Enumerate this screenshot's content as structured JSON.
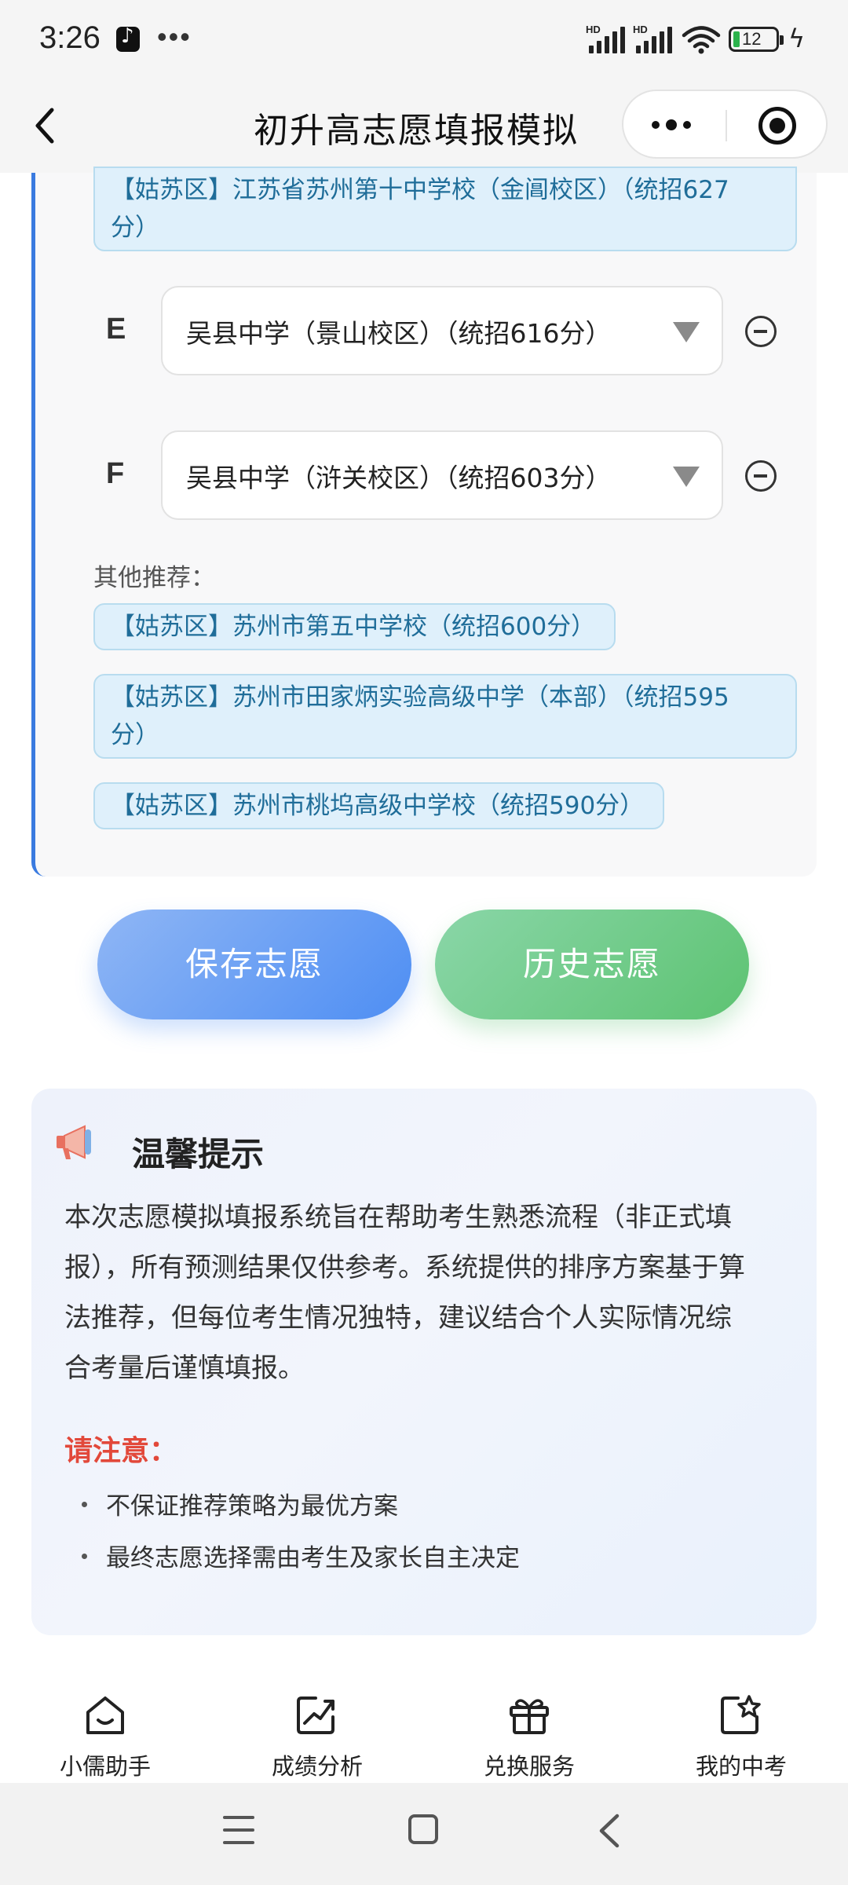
{
  "status_bar": {
    "time": "3:26",
    "more": "•••",
    "battery_level": "12",
    "icons": [
      "tiktok-icon",
      "signal-hd-icon",
      "signal-hd-icon",
      "wifi-icon",
      "battery-icon",
      "charging-bolt-icon"
    ]
  },
  "nav": {
    "title": "初升高志愿填报模拟",
    "icons": [
      "back-icon",
      "more-icon",
      "target-icon"
    ]
  },
  "volunteer": {
    "top_partial_tag": {
      "line1": "【姑苏区】江苏省苏州第十中学校（金阊校区）（统招627",
      "line2": "分）"
    },
    "rows": [
      {
        "label": "E",
        "selected": "吴县中学（景山校区）（统招616分）"
      },
      {
        "label": "F",
        "selected": "吴县中学（浒关校区）（统招603分）"
      }
    ],
    "other_label": "其他推荐：",
    "recommendations": [
      {
        "line1": "【姑苏区】苏州市第五中学校（统招600分）",
        "line2": ""
      },
      {
        "line1": "【姑苏区】苏州市田家炳实验高级中学（本部）（统招595",
        "line2": "分）"
      },
      {
        "line1": "【姑苏区】苏州市桃坞高级中学校（统招590分）",
        "line2": ""
      }
    ]
  },
  "actions": {
    "save": "保存志愿",
    "history": "历史志愿"
  },
  "tips": {
    "title": "温馨提示",
    "lines": [
      "本次志愿模拟填报系统旨在帮助考生熟悉流程（非正式填",
      "报），所有预测结果仅供参考。系统提供的排序方案基于算",
      "法推荐，但每位考生情况独特，建议结合个人实际情况综",
      "合考量后谨慎填报。"
    ],
    "notice_title": "请注意：",
    "bullets": [
      "不保证推荐策略为最优方案",
      "最终志愿选择需由考生及家长自主决定"
    ]
  },
  "tab_bar": {
    "items": [
      {
        "label": "小儒助手",
        "icon": "home-smile-icon"
      },
      {
        "label": "成绩分析",
        "icon": "chart-trend-icon"
      },
      {
        "label": "兑换服务",
        "icon": "gift-icon"
      },
      {
        "label": "我的中考",
        "icon": "star-doc-icon"
      }
    ]
  },
  "system_nav": {
    "icons": [
      "menu-icon",
      "home-square-icon",
      "back-triangle-icon"
    ]
  },
  "colors": {
    "accent_blue": "#3a7be0",
    "tag_bg": "#dff0fb",
    "tag_text": "#1f6d99",
    "save_button": "#4e8ef3",
    "history_button": "#5dc372",
    "notice_red": "#e2483a"
  }
}
